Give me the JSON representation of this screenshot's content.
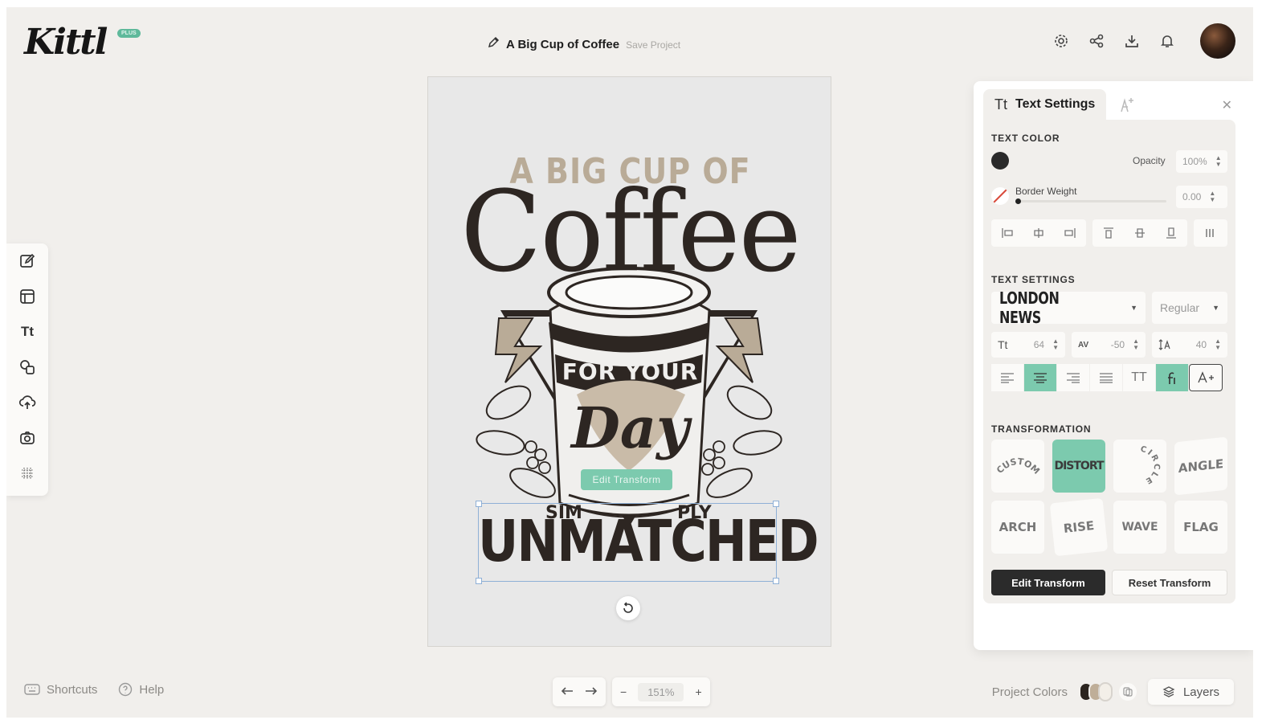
{
  "brand": {
    "logo": "Kittl",
    "plan": "PLUS"
  },
  "project": {
    "title": "A Big Cup of Coffee",
    "save": "Save Project"
  },
  "top_icons": [
    "settings-icon",
    "share-icon",
    "download-icon",
    "bell-icon"
  ],
  "left_tools": [
    "edit-icon",
    "templates-icon",
    "text-icon",
    "shapes-icon",
    "upload-icon",
    "camera-icon",
    "grid-icon"
  ],
  "left_tools_text": "Tt",
  "design": {
    "line1": "A BIG CUP OF",
    "line2": "Coffee",
    "cup_band": "FOR YOUR",
    "script": "Day",
    "simply_left": "SIM",
    "simply_right": "PLY",
    "main": "UNMATCHED",
    "edit_chip": "Edit Transform"
  },
  "bottom": {
    "shortcuts": "Shortcuts",
    "help": "Help",
    "zoom": "151%",
    "minus": "−",
    "plus": "+",
    "project_colors": "Project Colors",
    "layers": "Layers",
    "swatch_colors": [
      "#2b241f",
      "#bfae98",
      "#f3efe8"
    ]
  },
  "panel": {
    "tab_icon": "Tt",
    "tab_title": "Text Settings",
    "text_color_title": "TEXT COLOR",
    "text_color": "#2a2a2a",
    "opacity_label": "Opacity",
    "opacity_value": "100%",
    "border_label": "Border Weight",
    "border_value": "0.00",
    "text_settings_title": "TEXT SETTINGS",
    "font_name": "LONDON NEWS",
    "font_style": "Regular",
    "size_icon": "Tt",
    "size": "64",
    "spacing_icon": "AV",
    "spacing": "-50",
    "lineheight": "40",
    "case_icon": "TT",
    "transformation_title": "TRANSFORMATION",
    "transforms": [
      "CUSTOM",
      "DISTORT",
      "CIRCLE",
      "ANGLE",
      "ARCH",
      "RISE",
      "WAVE",
      "FLAG"
    ],
    "active_transform": "DISTORT",
    "edit_btn": "Edit Transform",
    "reset_btn": "Reset Transform",
    "accent": "#7ccaae"
  }
}
